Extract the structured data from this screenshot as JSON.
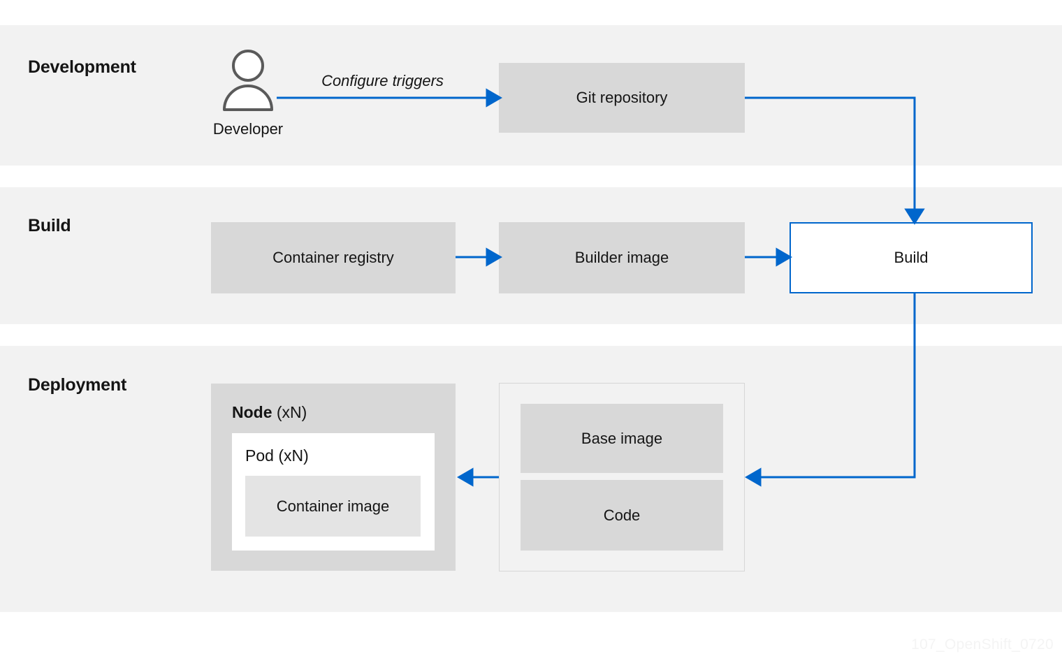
{
  "bands": [
    {
      "title": "Development"
    },
    {
      "title": "Build"
    },
    {
      "title": "Deployment"
    }
  ],
  "development": {
    "title": "Development",
    "developer_label": "Developer",
    "developer_icon": "person-icon",
    "edge_label": "Configure triggers",
    "git_repository": "Git repository"
  },
  "build": {
    "title": "Build",
    "container_registry": "Container registry",
    "builder_image": "Builder image",
    "build": "Build"
  },
  "deployment": {
    "title": "Deployment",
    "node_label": "Node",
    "node_multiplier": " (xN)",
    "pod_label": "Pod (xN)",
    "container_image": "Container image",
    "base_image": "Base image",
    "code": "Code"
  },
  "colors": {
    "band_background": "#f2f2f2",
    "page_background": "#ffffff",
    "box_gray": "#d8d8d8",
    "box_light_gray": "#e4e4e4",
    "accent_blue": "#0066cc",
    "icon_gray": "#5a5a5a",
    "text": "#151515",
    "watermark": "#f4f4f4"
  },
  "watermark": "107_OpenShift_0720"
}
